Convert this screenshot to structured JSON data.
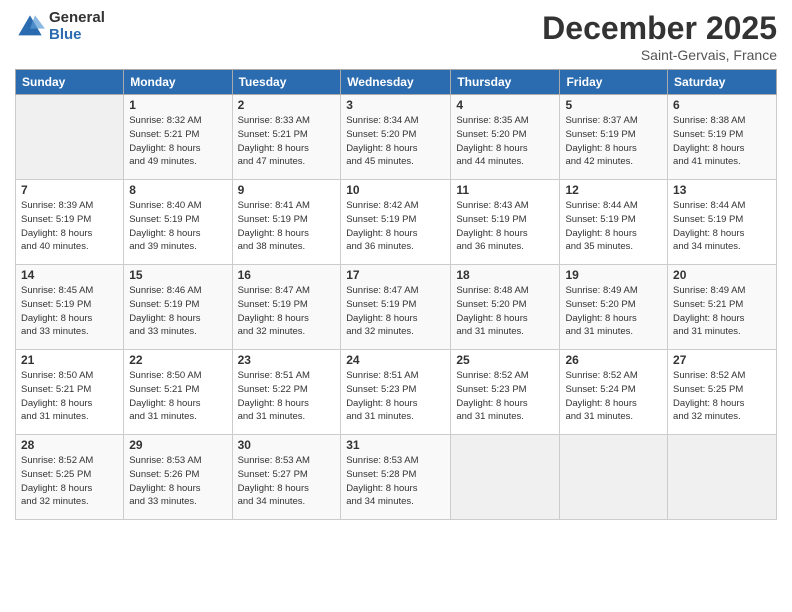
{
  "header": {
    "logo_general": "General",
    "logo_blue": "Blue",
    "month_title": "December 2025",
    "subtitle": "Saint-Gervais, France"
  },
  "days_of_week": [
    "Sunday",
    "Monday",
    "Tuesday",
    "Wednesday",
    "Thursday",
    "Friday",
    "Saturday"
  ],
  "weeks": [
    [
      {
        "day": "",
        "info": ""
      },
      {
        "day": "1",
        "info": "Sunrise: 8:32 AM\nSunset: 5:21 PM\nDaylight: 8 hours\nand 49 minutes."
      },
      {
        "day": "2",
        "info": "Sunrise: 8:33 AM\nSunset: 5:21 PM\nDaylight: 8 hours\nand 47 minutes."
      },
      {
        "day": "3",
        "info": "Sunrise: 8:34 AM\nSunset: 5:20 PM\nDaylight: 8 hours\nand 45 minutes."
      },
      {
        "day": "4",
        "info": "Sunrise: 8:35 AM\nSunset: 5:20 PM\nDaylight: 8 hours\nand 44 minutes."
      },
      {
        "day": "5",
        "info": "Sunrise: 8:37 AM\nSunset: 5:19 PM\nDaylight: 8 hours\nand 42 minutes."
      },
      {
        "day": "6",
        "info": "Sunrise: 8:38 AM\nSunset: 5:19 PM\nDaylight: 8 hours\nand 41 minutes."
      }
    ],
    [
      {
        "day": "7",
        "info": "Sunrise: 8:39 AM\nSunset: 5:19 PM\nDaylight: 8 hours\nand 40 minutes."
      },
      {
        "day": "8",
        "info": "Sunrise: 8:40 AM\nSunset: 5:19 PM\nDaylight: 8 hours\nand 39 minutes."
      },
      {
        "day": "9",
        "info": "Sunrise: 8:41 AM\nSunset: 5:19 PM\nDaylight: 8 hours\nand 38 minutes."
      },
      {
        "day": "10",
        "info": "Sunrise: 8:42 AM\nSunset: 5:19 PM\nDaylight: 8 hours\nand 36 minutes."
      },
      {
        "day": "11",
        "info": "Sunrise: 8:43 AM\nSunset: 5:19 PM\nDaylight: 8 hours\nand 36 minutes."
      },
      {
        "day": "12",
        "info": "Sunrise: 8:44 AM\nSunset: 5:19 PM\nDaylight: 8 hours\nand 35 minutes."
      },
      {
        "day": "13",
        "info": "Sunrise: 8:44 AM\nSunset: 5:19 PM\nDaylight: 8 hours\nand 34 minutes."
      }
    ],
    [
      {
        "day": "14",
        "info": "Sunrise: 8:45 AM\nSunset: 5:19 PM\nDaylight: 8 hours\nand 33 minutes."
      },
      {
        "day": "15",
        "info": "Sunrise: 8:46 AM\nSunset: 5:19 PM\nDaylight: 8 hours\nand 33 minutes."
      },
      {
        "day": "16",
        "info": "Sunrise: 8:47 AM\nSunset: 5:19 PM\nDaylight: 8 hours\nand 32 minutes."
      },
      {
        "day": "17",
        "info": "Sunrise: 8:47 AM\nSunset: 5:19 PM\nDaylight: 8 hours\nand 32 minutes."
      },
      {
        "day": "18",
        "info": "Sunrise: 8:48 AM\nSunset: 5:20 PM\nDaylight: 8 hours\nand 31 minutes."
      },
      {
        "day": "19",
        "info": "Sunrise: 8:49 AM\nSunset: 5:20 PM\nDaylight: 8 hours\nand 31 minutes."
      },
      {
        "day": "20",
        "info": "Sunrise: 8:49 AM\nSunset: 5:21 PM\nDaylight: 8 hours\nand 31 minutes."
      }
    ],
    [
      {
        "day": "21",
        "info": "Sunrise: 8:50 AM\nSunset: 5:21 PM\nDaylight: 8 hours\nand 31 minutes."
      },
      {
        "day": "22",
        "info": "Sunrise: 8:50 AM\nSunset: 5:21 PM\nDaylight: 8 hours\nand 31 minutes."
      },
      {
        "day": "23",
        "info": "Sunrise: 8:51 AM\nSunset: 5:22 PM\nDaylight: 8 hours\nand 31 minutes."
      },
      {
        "day": "24",
        "info": "Sunrise: 8:51 AM\nSunset: 5:23 PM\nDaylight: 8 hours\nand 31 minutes."
      },
      {
        "day": "25",
        "info": "Sunrise: 8:52 AM\nSunset: 5:23 PM\nDaylight: 8 hours\nand 31 minutes."
      },
      {
        "day": "26",
        "info": "Sunrise: 8:52 AM\nSunset: 5:24 PM\nDaylight: 8 hours\nand 31 minutes."
      },
      {
        "day": "27",
        "info": "Sunrise: 8:52 AM\nSunset: 5:25 PM\nDaylight: 8 hours\nand 32 minutes."
      }
    ],
    [
      {
        "day": "28",
        "info": "Sunrise: 8:52 AM\nSunset: 5:25 PM\nDaylight: 8 hours\nand 32 minutes."
      },
      {
        "day": "29",
        "info": "Sunrise: 8:53 AM\nSunset: 5:26 PM\nDaylight: 8 hours\nand 33 minutes."
      },
      {
        "day": "30",
        "info": "Sunrise: 8:53 AM\nSunset: 5:27 PM\nDaylight: 8 hours\nand 34 minutes."
      },
      {
        "day": "31",
        "info": "Sunrise: 8:53 AM\nSunset: 5:28 PM\nDaylight: 8 hours\nand 34 minutes."
      },
      {
        "day": "",
        "info": ""
      },
      {
        "day": "",
        "info": ""
      },
      {
        "day": "",
        "info": ""
      }
    ]
  ]
}
